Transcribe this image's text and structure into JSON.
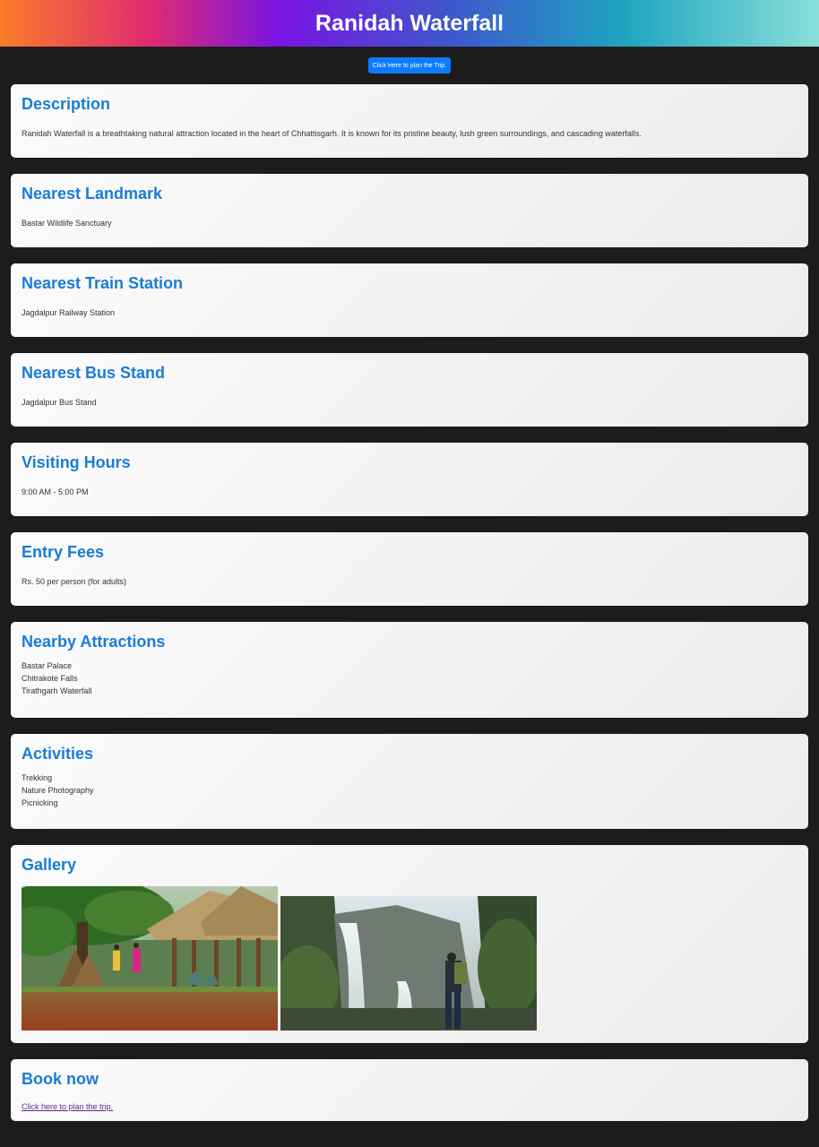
{
  "header": {
    "title": "Ranidah Waterfall"
  },
  "plan_button": {
    "label": "Click Here to plan the Trip."
  },
  "sections": {
    "description": {
      "heading": "Description",
      "text": "Ranidah Waterfall is a breathtaking natural attraction located in the heart of Chhattisgarh. It is known for its pristine beauty, lush green surroundings, and cascading waterfalls."
    },
    "landmark": {
      "heading": "Nearest Landmark",
      "text": "Bastar Wildlife Sanctuary"
    },
    "train": {
      "heading": "Nearest Train Station",
      "text": "Jagdalpur Railway Station"
    },
    "bus": {
      "heading": "Nearest Bus Stand",
      "text": "Jagdalpur Bus Stand"
    },
    "hours": {
      "heading": "Visiting Hours",
      "text": "9:00 AM - 5:00 PM"
    },
    "fees": {
      "heading": "Entry Fees",
      "text": "Rs. 50 per person (for adults)"
    },
    "attractions": {
      "heading": "Nearby Attractions",
      "items": [
        "Bastar Palace",
        "Chitrakote Falls",
        "Tirathgarh Waterfall"
      ]
    },
    "activities": {
      "heading": "Activities",
      "items": [
        "Trekking",
        "Nature Photography",
        "Picnicking"
      ]
    },
    "gallery": {
      "heading": "Gallery"
    },
    "book": {
      "heading": "Book now",
      "link": "Click here to plan the trip."
    }
  },
  "colors": {
    "heading": "#1a7cd6",
    "button": "#0b7bff",
    "page_bg": "#1c1c1c",
    "link": "#5a2a8c"
  }
}
